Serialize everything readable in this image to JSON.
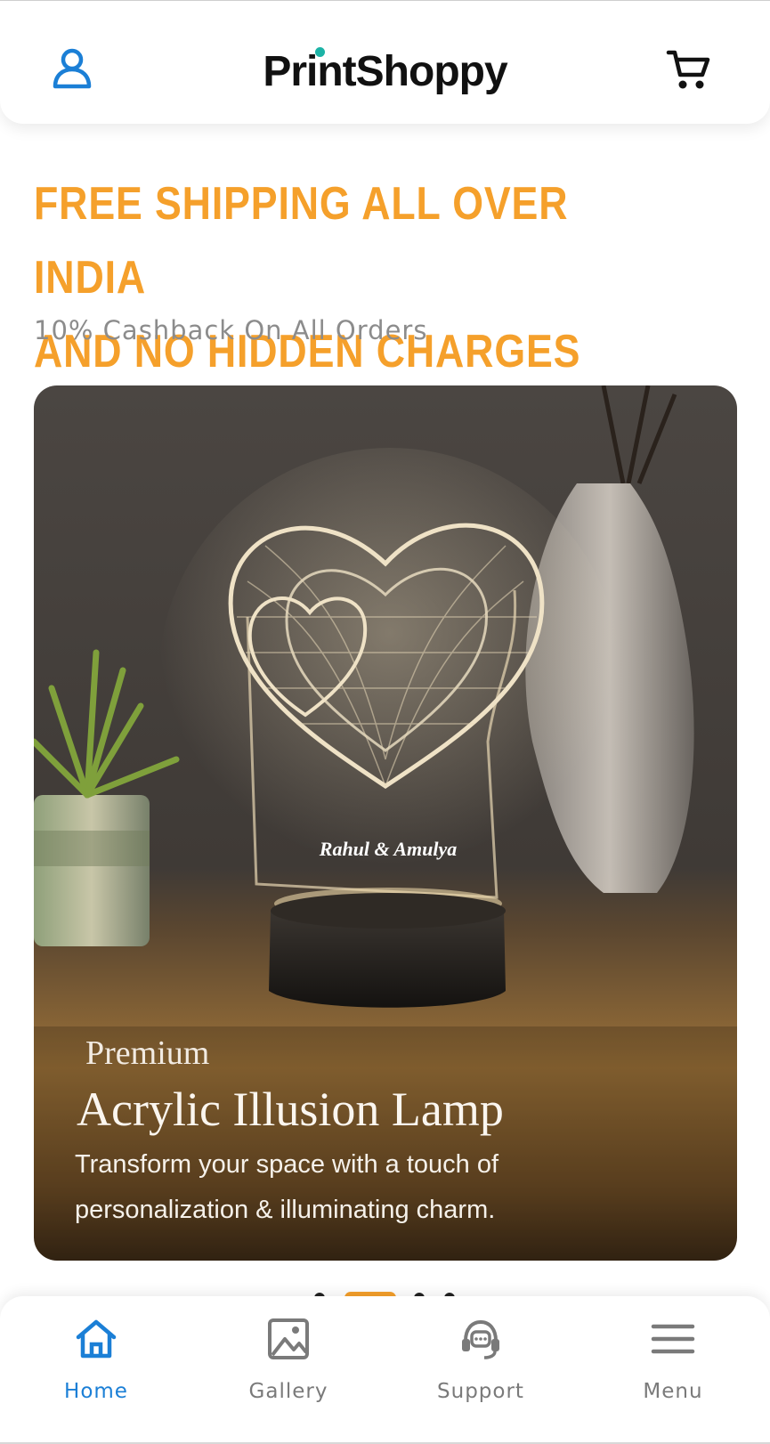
{
  "header": {
    "logo_text": "PrintShoppy",
    "user_icon": "user-icon",
    "cart_icon": "cart-icon",
    "accent_color": "#1b7fd6",
    "logo_dot_color": "#1cb3a6"
  },
  "promo": {
    "line1": "FREE SHIPPING ALL OVER INDIA",
    "line2": "AND NO HIDDEN CHARGES",
    "sub": "10% Cashback On All Orders",
    "color": "#f5a02b"
  },
  "banner": {
    "engraving": "Rahul & Amulya",
    "pre_title": "Premium",
    "title": "Acrylic Illusion Lamp",
    "description": "Transform your space with a touch of personalization & illuminating charm."
  },
  "carousel": {
    "slide_count": 4,
    "active_index": 1
  },
  "bottom_nav": {
    "items": [
      {
        "label": "Home",
        "icon": "home-icon",
        "active": true
      },
      {
        "label": "Gallery",
        "icon": "image-icon",
        "active": false
      },
      {
        "label": "Support",
        "icon": "headset-icon",
        "active": false
      },
      {
        "label": "Menu",
        "icon": "hamburger-icon",
        "active": false
      }
    ]
  }
}
